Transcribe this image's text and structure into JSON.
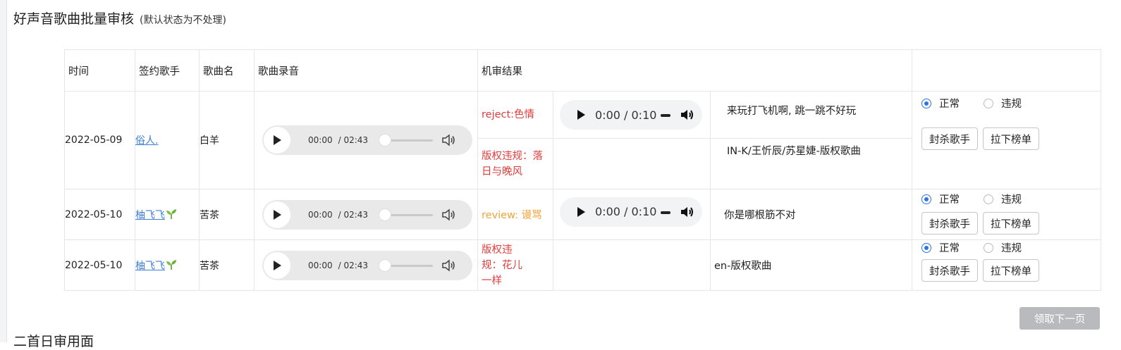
{
  "page": {
    "title": "好声音歌曲批量审核",
    "title_hint": "(默认状态为不处理)",
    "next_button": "领取下一页",
    "next_section_title": "二首日审用面"
  },
  "table": {
    "headers": [
      "时间",
      "签约歌手",
      "歌曲名",
      "歌曲录音",
      "机审结果",
      ""
    ],
    "rows": [
      {
        "date": "2022-05-09",
        "singer": "俗人.",
        "song": "白羊",
        "audio": {
          "current": "00:00",
          "duration": "/ 02:43"
        },
        "results": [
          {
            "reason": "reject:色情",
            "reason_color": "red",
            "clip": {
              "time": "0:00 / 0:10"
            },
            "text": "来玩打飞机啊, 跳一跳不好玩"
          },
          {
            "reason": "版权违规：落日与晚风",
            "reason_color": "red",
            "clip": null,
            "text": "IN-K/王忻辰/苏星婕-版权歌曲"
          }
        ],
        "status": {
          "normal": "正常",
          "violation": "违规",
          "selected": "normal"
        },
        "actions": {
          "ban": "封杀歌手",
          "remove": "拉下榜单"
        }
      },
      {
        "date": "2022-05-10",
        "singer": "柚飞飞",
        "song": "苦茶",
        "audio": {
          "current": "00:00",
          "duration": "/ 02:43"
        },
        "results": [
          {
            "reason": "review: 谩骂",
            "reason_color": "orange",
            "clip": {
              "time": "0:00 / 0:10"
            },
            "text": "你是哪根筋不对"
          }
        ],
        "status": {
          "normal": "正常",
          "violation": "违规",
          "selected": "normal"
        },
        "actions": {
          "ban": "封杀歌手",
          "remove": "拉下榜单"
        }
      },
      {
        "date": "2022-05-10",
        "singer": "柚飞飞",
        "song": "苦茶",
        "audio": {
          "current": "00:00",
          "duration": "/ 02:43"
        },
        "results": [
          {
            "reason": "版权违规：花儿一样",
            "reason_color": "red",
            "clip": null,
            "text": "en-版权歌曲"
          }
        ],
        "status": {
          "normal": "正常",
          "violation": "违规",
          "selected": "normal"
        },
        "actions": {
          "ban": "封杀歌手",
          "remove": "拉下榜单"
        }
      }
    ]
  },
  "colors": {
    "link": "#3d7fd6",
    "reject": "#e23b3b",
    "review": "#f0a33a",
    "radio_on": "#2b74e3",
    "next_button_bg": "#b8babd"
  },
  "icons": [
    "play-icon",
    "volume-icon",
    "sprout-icon"
  ]
}
